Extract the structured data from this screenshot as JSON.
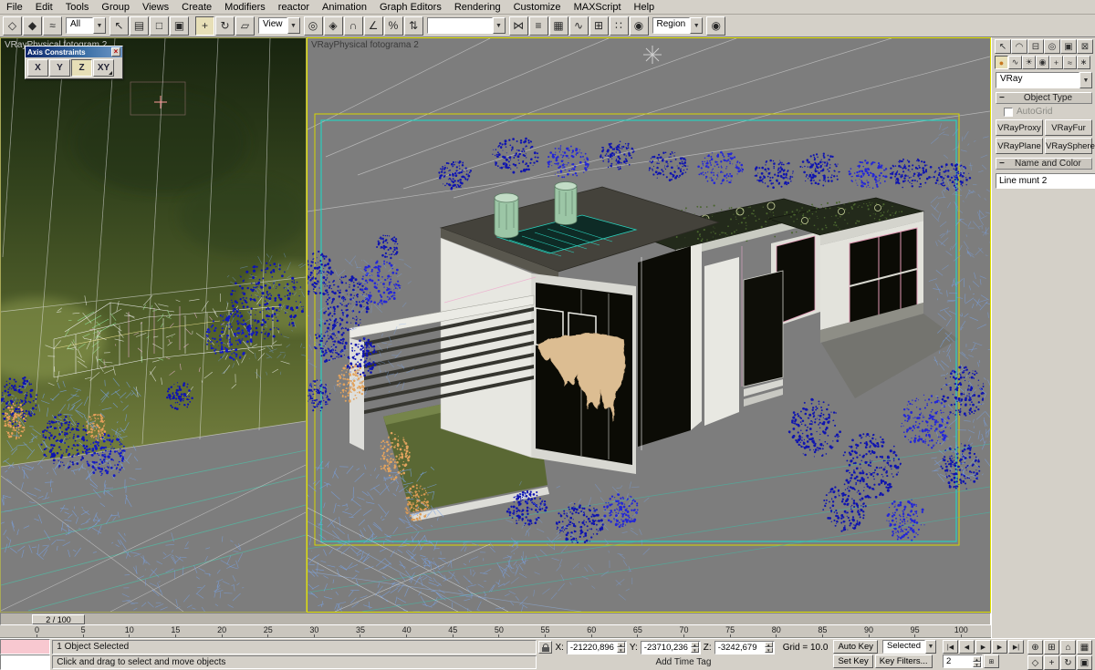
{
  "menubar": {
    "items": [
      "File",
      "Edit",
      "Tools",
      "Group",
      "Views",
      "Create",
      "Modifiers",
      "reactor",
      "Animation",
      "Graph Editors",
      "Rendering",
      "Customize",
      "MAXScript",
      "Help"
    ]
  },
  "toolbar": {
    "icons_left": [
      {
        "name": "select-and-link-icon",
        "glyph": "◇"
      },
      {
        "name": "unlink-selection-icon",
        "glyph": "◆"
      },
      {
        "name": "bind-to-space-warp-icon",
        "glyph": "≈"
      }
    ],
    "selection_filter_value": "All",
    "icons_select": [
      {
        "name": "select-object-icon",
        "glyph": "↖"
      },
      {
        "name": "select-by-name-icon",
        "glyph": "▤"
      },
      {
        "name": "rectangular-selection-region-icon",
        "glyph": "□"
      },
      {
        "name": "window-crossing-icon",
        "glyph": "▣"
      }
    ],
    "icons_transform": [
      {
        "name": "select-and-move-icon",
        "glyph": "+",
        "pressed": true
      },
      {
        "name": "select-and-rotate-icon",
        "glyph": "↻"
      },
      {
        "name": "select-and-scale-icon",
        "glyph": "▱"
      }
    ],
    "ref_coord_value": "View",
    "icons_mid": [
      {
        "name": "use-pivot-point-center-icon",
        "glyph": "◎"
      },
      {
        "name": "select-and-manipulate-icon",
        "glyph": "◈"
      },
      {
        "name": "snap-toggle-icon",
        "glyph": "∩"
      },
      {
        "name": "angle-snap-icon",
        "glyph": "∠"
      },
      {
        "name": "percent-snap-icon",
        "glyph": "%"
      },
      {
        "name": "spinner-snap-icon",
        "glyph": "⇅"
      }
    ],
    "named_selection_value": "",
    "icons_right": [
      {
        "name": "mirror-icon",
        "glyph": "⋈"
      },
      {
        "name": "align-icon",
        "glyph": "≡"
      },
      {
        "name": "layer-manager-icon",
        "glyph": "▦"
      },
      {
        "name": "curve-editor-icon",
        "glyph": "∿"
      },
      {
        "name": "schematic-view-icon",
        "glyph": "⊞"
      },
      {
        "name": "material-editor-icon",
        "glyph": "∷"
      },
      {
        "name": "render-scene-icon",
        "glyph": "◉"
      }
    ],
    "render_type_value": "Region",
    "icons_render": [
      {
        "name": "quick-render-icon",
        "glyph": "◉"
      }
    ]
  },
  "axis_constraints": {
    "title": "Axis Constraints",
    "close_glyph": "×",
    "buttons": [
      {
        "label": "X"
      },
      {
        "label": "Y"
      },
      {
        "label": "Z",
        "active": true
      },
      {
        "label": "XY"
      }
    ]
  },
  "viewport_left": {
    "label": "VRayPhysical fotogram 2"
  },
  "viewport_main": {
    "label": "VRayPhysical fotograma 2"
  },
  "command_panel": {
    "tabs": [
      {
        "name": "tab-create",
        "glyph": "↖"
      },
      {
        "name": "tab-modify",
        "glyph": "◠"
      },
      {
        "name": "tab-hierarchy",
        "glyph": "⊟"
      },
      {
        "name": "tab-motion",
        "glyph": "◎"
      },
      {
        "name": "tab-display",
        "glyph": "▣"
      },
      {
        "name": "tab-utilities",
        "glyph": "⊠"
      }
    ],
    "categories": [
      {
        "name": "category-geometry",
        "glyph": "●",
        "pressed": true
      },
      {
        "name": "category-shapes",
        "glyph": "∿"
      },
      {
        "name": "category-lights",
        "glyph": "☀"
      },
      {
        "name": "category-cameras",
        "glyph": "◉"
      },
      {
        "name": "category-helpers",
        "glyph": "+"
      },
      {
        "name": "category-space-warps",
        "glyph": "≈"
      },
      {
        "name": "category-systems",
        "glyph": "∗"
      }
    ],
    "subcategory_value": "VRay",
    "object_type_label": "Object Type",
    "autogrid_label": "AutoGrid",
    "object_buttons": [
      "VRayProxy",
      "VRayFur",
      "VRayPlane",
      "VRaySphere"
    ],
    "name_color_label": "Name and Color",
    "object_name_value": "Line munt 2"
  },
  "timeline": {
    "slider_label": "2 / 100",
    "ticks": [
      "0",
      "5",
      "10",
      "15",
      "20",
      "25",
      "30",
      "35",
      "40",
      "45",
      "50",
      "55",
      "60",
      "65",
      "70",
      "75",
      "80",
      "85",
      "90",
      "95",
      "100"
    ]
  },
  "status_bar": {
    "selection_text": "1 Object Selected",
    "prompt_text": "Click and drag to select and move objects",
    "x_label": "X:",
    "x_value": "-21220,896",
    "y_label": "Y:",
    "y_value": "-23710,236",
    "z_label": "Z:",
    "z_value": "-3242,679",
    "grid_text": "Grid = 10.0",
    "add_time_tag": "Add Time Tag",
    "auto_key": "Auto Key",
    "set_key": "Set Key",
    "key_filters": "Key Filters...",
    "selected_value": "Selected",
    "frame_value": "2"
  },
  "transport": {
    "buttons": [
      {
        "name": "go-to-start-button",
        "glyph": "|◀"
      },
      {
        "name": "previous-frame-button",
        "glyph": "◀"
      },
      {
        "name": "play-button",
        "glyph": "▶"
      },
      {
        "name": "next-frame-button",
        "glyph": "▶"
      },
      {
        "name": "go-to-end-button",
        "glyph": "▶|"
      }
    ]
  },
  "viewport_nav": {
    "icons": [
      {
        "name": "zoom-icon",
        "glyph": "⊕"
      },
      {
        "name": "zoom-all-icon",
        "glyph": "⊞"
      },
      {
        "name": "zoom-extents-icon",
        "glyph": "⌂"
      },
      {
        "name": "zoom-extents-all-icon",
        "glyph": "▦"
      },
      {
        "name": "field-of-view-icon",
        "glyph": "◇"
      },
      {
        "name": "pan-icon",
        "glyph": "+"
      },
      {
        "name": "arc-rotate-icon",
        "glyph": "↻"
      },
      {
        "name": "min-max-toggle-icon",
        "glyph": "▣"
      }
    ]
  }
}
